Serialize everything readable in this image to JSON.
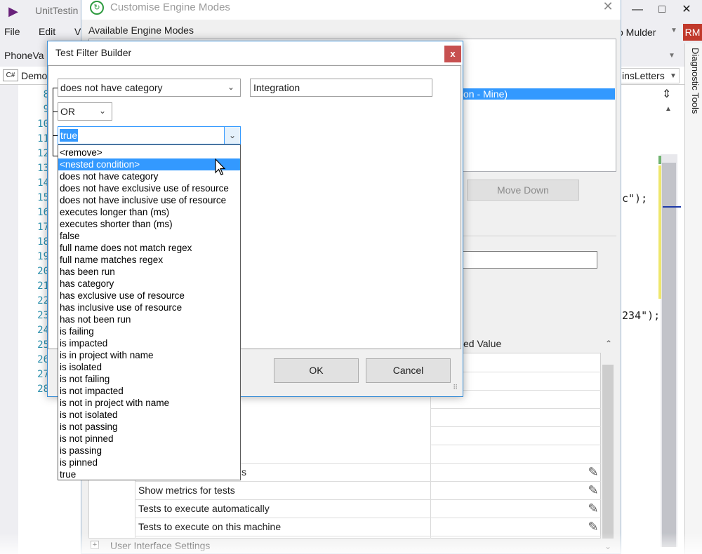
{
  "vs": {
    "title": "UnitTestin",
    "menu": [
      "File",
      "Edit",
      "V"
    ],
    "user_name": "o Mulder",
    "avatar_initials": "RM",
    "project_combo": "PhoneVa",
    "file_tab": "Demo",
    "member_dropdown": "insLetters",
    "diagnostic_tools": "Diagnostic Tools",
    "line_numbers": [
      "8",
      "9",
      "10",
      "11",
      "12",
      "13",
      "14",
      "15",
      "16",
      "17",
      "18",
      "19",
      "20",
      "21",
      "22",
      "23",
      "24",
      "25",
      "26",
      "27",
      "28"
    ],
    "code_fragment_1": "c\");",
    "code_fragment_2": "234\");"
  },
  "cem": {
    "title": "Customise Engine Modes",
    "available_label": "Available Engine Modes",
    "selected_mode": "on - Mine)",
    "move_down_label": "Move Down",
    "grid_header": "ed Value",
    "rows": [
      "s",
      "Show metrics for tests",
      "Tests to execute automatically",
      "Tests to execute on this machine"
    ],
    "ui_settings": "User Interface Settings"
  },
  "tfb": {
    "title": "Test Filter Builder",
    "close_label": "x",
    "condition1": "does not have category",
    "condition1_value": "Integration",
    "operator": "OR",
    "condition2": "true",
    "dropdown_items": [
      "<remove>",
      "<nested condition>",
      "does not have category",
      "does not have exclusive use of resource",
      "does not have inclusive use of resource",
      "executes longer than (ms)",
      "executes shorter than (ms)",
      "false",
      "full name does not match regex",
      "full name matches regex",
      "has been run",
      "has category",
      "has exclusive use of resource",
      "has inclusive use of resource",
      "has not been run",
      "is failing",
      "is impacted",
      "is in project with name",
      "is isolated",
      "is not failing",
      "is not impacted",
      "is not in project with name",
      "is not isolated",
      "is not passing",
      "is not pinned",
      "is passing",
      "is pinned",
      "true"
    ],
    "selected_index": 1,
    "ok_label": "OK",
    "cancel_label": "Cancel"
  },
  "colors": {
    "selection": "#3399ff",
    "close_red": "#c75050",
    "line_number": "#2b91af"
  }
}
